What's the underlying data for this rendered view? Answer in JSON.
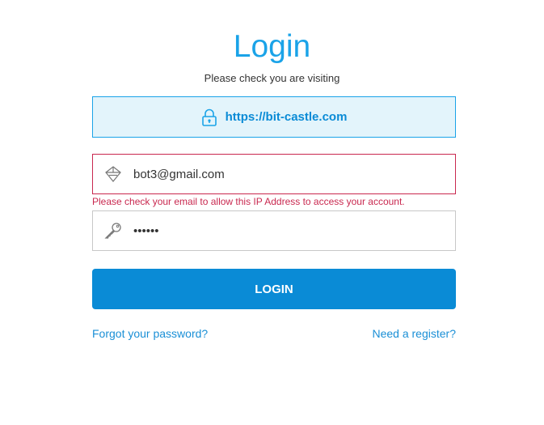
{
  "header": {
    "title": "Login",
    "subtitle": "Please check you are visiting"
  },
  "url_check": {
    "url": "https://bit-castle.com",
    "icon": "lock-icon"
  },
  "email": {
    "value": "bot3@gmail.com",
    "icon": "email-icon",
    "error": "Please check your email to allow this IP Address to access your account."
  },
  "password": {
    "masked_value": "••••••",
    "icon": "key-icon"
  },
  "actions": {
    "login_label": "LOGIN",
    "forgot_label": "Forgot your password?",
    "register_label": "Need a register?"
  },
  "colors": {
    "accent": "#1aa3e8",
    "button": "#0a8bd6",
    "error": "#c9284f",
    "url_bg": "#e3f4fb"
  }
}
